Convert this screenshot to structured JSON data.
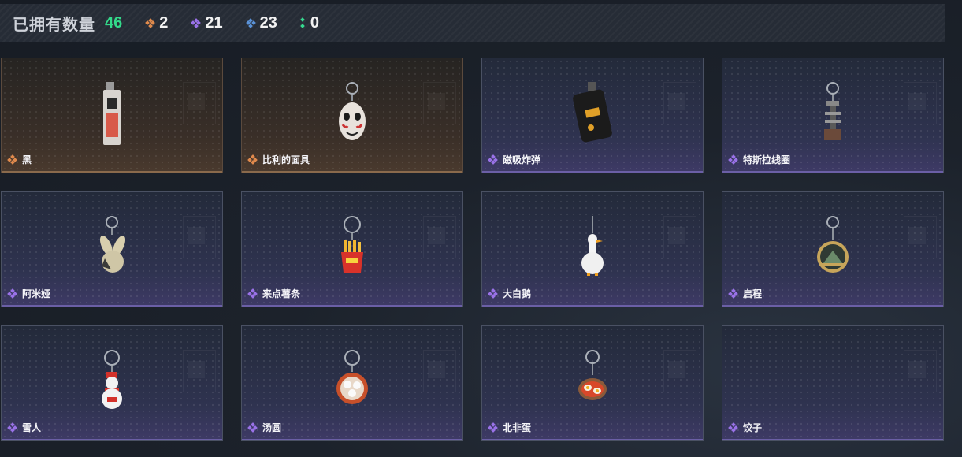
{
  "header": {
    "title": "已拥有数量",
    "total": "46",
    "stats": [
      {
        "color": "orange",
        "icon": "orange-rarity-icon",
        "value": "2"
      },
      {
        "color": "purple",
        "icon": "purple-rarity-icon",
        "value": "21"
      },
      {
        "color": "blue",
        "icon": "blue-rarity-icon",
        "value": "23"
      },
      {
        "color": "green",
        "icon": "green-rarity-icon",
        "value": "0"
      }
    ]
  },
  "items": [
    {
      "name": "黑",
      "rarity": "orange",
      "icon": "phone-charm-icon"
    },
    {
      "name": "比利的面具",
      "rarity": "orange",
      "icon": "mask-charm-icon"
    },
    {
      "name": "磁吸炸弹",
      "rarity": "purple",
      "icon": "bomb-charm-icon"
    },
    {
      "name": "特斯拉线圈",
      "rarity": "purple",
      "icon": "tesla-coil-charm-icon"
    },
    {
      "name": "阿米娅",
      "rarity": "purple",
      "icon": "bunny-charm-icon"
    },
    {
      "name": "来点薯条",
      "rarity": "purple",
      "icon": "fries-charm-icon"
    },
    {
      "name": "大白鹅",
      "rarity": "purple",
      "icon": "goose-charm-icon"
    },
    {
      "name": "启程",
      "rarity": "purple",
      "icon": "medal-charm-icon"
    },
    {
      "name": "雪人",
      "rarity": "purple",
      "icon": "snowman-charm-icon"
    },
    {
      "name": "汤圆",
      "rarity": "purple",
      "icon": "tangyuan-charm-icon"
    },
    {
      "name": "北非蛋",
      "rarity": "purple",
      "icon": "shakshuka-charm-icon"
    },
    {
      "name": "饺子",
      "rarity": "purple",
      "icon": "dumpling-charm-icon"
    }
  ],
  "colors": {
    "orange": "#e08a4c",
    "purple": "#9a72e8",
    "blue": "#5a92d8",
    "green": "#36d990",
    "total": "#33d98a"
  }
}
